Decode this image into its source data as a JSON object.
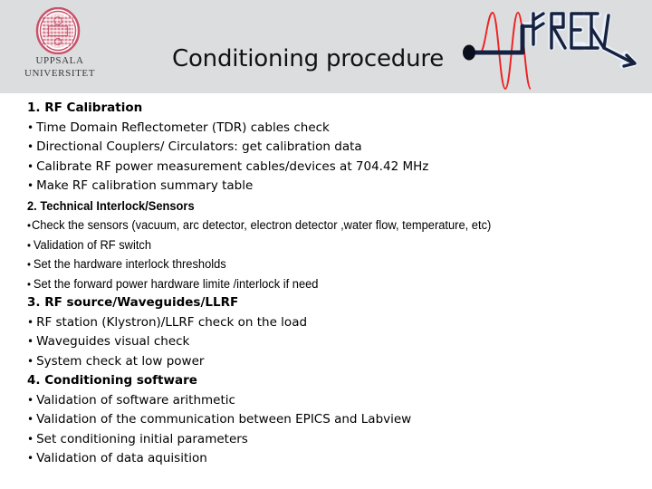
{
  "slide": {
    "title": "Conditioning procedure",
    "header_bg": "#dcdddf",
    "body_bg": "#ffffff",
    "title_color": "#121212"
  },
  "uppsala_logo": {
    "name": "uppsala-university-logo",
    "line1": "UPPSALA",
    "line2": "UNIVERSITET",
    "seal_color": "#c8536b",
    "text_color": "#3a3a3c"
  },
  "freia_logo": {
    "name": "freia-logo",
    "wordmark": "FREIA",
    "wave_color": "#ee2222",
    "line_color": "#16213e",
    "glow_color": "#dbe7f5"
  },
  "sections": [
    {
      "heading": "1. RF Calibration",
      "bullet": "•",
      "items": [
        "Time Domain Reflectometer (TDR) cables check",
        "Directional Couplers/ Circulators: get calibration data",
        "Calibrate RF power measurement cables/devices at 704.42 MHz",
        "Make RF calibration summary table"
      ]
    },
    {
      "heading": "2. Technical Interlock/Sensors",
      "bullet": "•",
      "items": [
        "Check the sensors (vacuum, arc detector, electron detector ,water flow, temperature, etc)",
        "Validation of RF switch",
        "Set the hardware interlock thresholds",
        "Set the forward power hardware limite /interlock if need"
      ]
    },
    {
      "heading": "3. RF source/Waveguides/LLRF",
      "bullet": "•",
      "items": [
        "RF station (Klystron)/LLRF check on the load",
        "Waveguides visual check",
        "System check at low power"
      ]
    },
    {
      "heading": "4. Conditioning software",
      "bullet": "•",
      "items": [
        "Validation of software arithmetic",
        "Validation of the communication between EPICS and Labview",
        "Set conditioning initial parameters",
        "Validation of data aquisition"
      ]
    }
  ]
}
